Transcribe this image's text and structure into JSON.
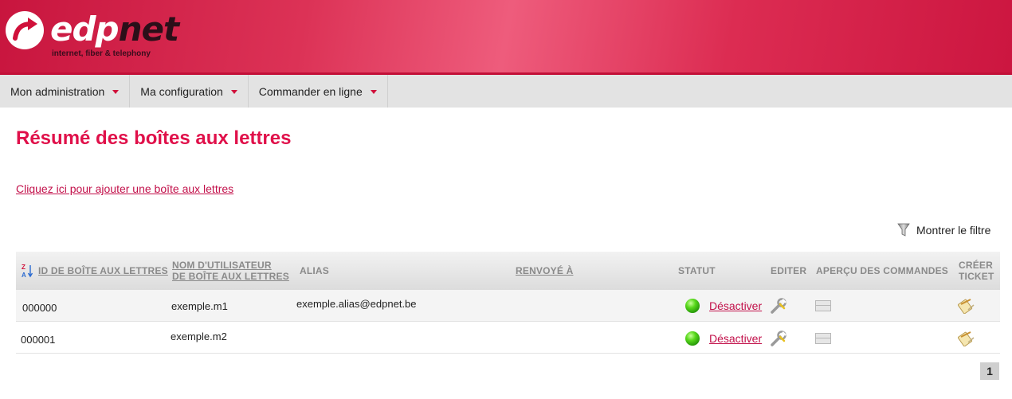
{
  "brand": {
    "name_part1": "edp",
    "name_part2": "net",
    "tagline": "internet, fiber & telephony",
    "accent": "#d0103a"
  },
  "nav": {
    "items": [
      {
        "label": "Mon administration"
      },
      {
        "label": "Ma configuration"
      },
      {
        "label": "Commander en ligne"
      }
    ]
  },
  "page": {
    "title": "Résumé des boîtes aux lettres",
    "add_link": "Cliquez ici pour ajouter une boîte aux lettres",
    "filter_label": "Montrer le filtre"
  },
  "table": {
    "headers": {
      "id": "ID DE BOÎTE AUX LETTRES",
      "username_line1": "NOM D'UTILISATEUR",
      "username_line2": "DE BOÎTE AUX LETTRES",
      "alias": "ALIAS",
      "forward": "RENVOYÉ À",
      "status": "STATUT",
      "edit": "EDITER",
      "preview": "APERÇU DES COMMANDES",
      "ticket_line1": "CRÉER",
      "ticket_line2": "TICKET"
    },
    "rows": [
      {
        "id": "000000",
        "username": "exemple.m1",
        "alias": "exemple.alias@edpnet.be",
        "forward": "",
        "status": "active",
        "action": "Désactiver"
      },
      {
        "id": "000001",
        "username": "exemple.m2",
        "alias": "",
        "forward": "",
        "status": "active",
        "action": "Désactiver"
      }
    ]
  },
  "pagination": {
    "current": "1"
  }
}
